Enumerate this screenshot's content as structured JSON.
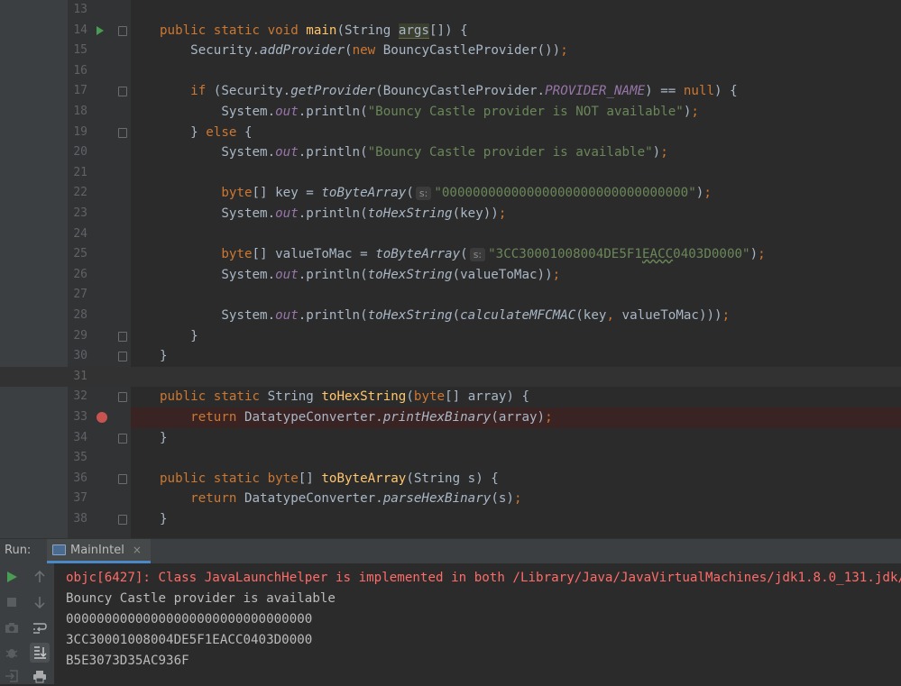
{
  "editor": {
    "lines": [
      {
        "n": "13",
        "html": ""
      },
      {
        "n": "14",
        "html": "<span class=\"kw\">public static void </span><span class=\"fn\">main</span>(String <span class=\"hl-args\">args</span>[]) {"
      },
      {
        "n": "15",
        "html": "    Security.<span class=\"it\">addProvider</span>(<span class=\"kw\">new </span>BouncyCastleProvider())<span class=\"kw\">;</span>"
      },
      {
        "n": "16",
        "html": ""
      },
      {
        "n": "17",
        "html": "    <span class=\"kw\">if </span>(Security.<span class=\"it\">getProvider</span>(BouncyCastleProvider.<span class=\"fld\">PROVIDER_NAME</span>) == <span class=\"kw\">null</span>) {"
      },
      {
        "n": "18",
        "html": "        System.<span class=\"fld\">out</span>.println(<span class=\"st\">\"Bouncy Castle provider is NOT available\"</span>)<span class=\"kw\">;</span>"
      },
      {
        "n": "19",
        "html": "    } <span class=\"kw\">else </span>{"
      },
      {
        "n": "20",
        "html": "        System.<span class=\"fld\">out</span>.println(<span class=\"st\">\"Bouncy Castle provider is available\"</span>)<span class=\"kw\">;</span>"
      },
      {
        "n": "21",
        "html": ""
      },
      {
        "n": "22",
        "html": "        <span class=\"kw\">byte</span>[] key = <span class=\"it\">toByteArray</span>(<span class=\"hint\">s:</span><span class=\"st\">\"00000000000000000000000000000000\"</span>)<span class=\"kw\">;</span>"
      },
      {
        "n": "23",
        "html": "        System.<span class=\"fld\">out</span>.println(<span class=\"it\">toHexString</span>(key))<span class=\"kw\">;</span>"
      },
      {
        "n": "24",
        "html": ""
      },
      {
        "n": "25",
        "html": "        <span class=\"kw\">byte</span>[] valueToMac = <span class=\"it\">toByteArray</span>(<span class=\"hint\">s:</span><span class=\"st\">\"3CC30001008004DE5F1<span class=\"typo\">EACC</span>0403D0000\"</span>)<span class=\"kw\">;</span>"
      },
      {
        "n": "26",
        "html": "        System.<span class=\"fld\">out</span>.println(<span class=\"it\">toHexString</span>(valueToMac))<span class=\"kw\">;</span>"
      },
      {
        "n": "27",
        "html": ""
      },
      {
        "n": "28",
        "html": "        System.<span class=\"fld\">out</span>.println(<span class=\"it\">toHexString</span>(<span class=\"it\">calculateMFCMAC</span>(key<span class=\"kw\">, </span>valueToMac)))<span class=\"kw\">;</span>"
      },
      {
        "n": "29",
        "html": "    }"
      },
      {
        "n": "30",
        "html": "}"
      },
      {
        "n": "31",
        "html": ""
      },
      {
        "n": "32",
        "html": "<span class=\"kw\">public static </span>String <span class=\"fn\">toHexString</span>(<span class=\"kw\">byte</span>[] array) {"
      },
      {
        "n": "33",
        "html": "    <span class=\"kw\">return </span>DatatypeConverter.<span class=\"it\">printHexBinary</span>(array)<span class=\"kw\">;</span>"
      },
      {
        "n": "34",
        "html": "}"
      },
      {
        "n": "35",
        "html": ""
      },
      {
        "n": "36",
        "html": "<span class=\"kw\">public static byte</span>[] <span class=\"fn\">toByteArray</span>(String s) {"
      },
      {
        "n": "37",
        "html": "    <span class=\"kw\">return </span>DatatypeConverter.<span class=\"it\">parseHexBinary</span>(s)<span class=\"kw\">;</span>"
      },
      {
        "n": "38",
        "html": "}"
      }
    ]
  },
  "run_panel": {
    "label": "Run:",
    "tab_label": "MainIntel",
    "tab_close": "×",
    "console": {
      "error_line": "objc[6427]: Class JavaLaunchHelper is implemented in both /Library/Java/JavaVirtualMachines/jdk1.8.0_131.jdk/",
      "out1": "Bouncy Castle provider is available",
      "out2": "00000000000000000000000000000000",
      "out3": "3CC30001008004DE5F1EACC0403D0000",
      "out4": "B5E3073D35AC936F"
    }
  },
  "colors": {
    "keyword": "#cc7832",
    "function": "#ffc66d",
    "string": "#6a8759",
    "field": "#9876aa",
    "error": "#ff6b68",
    "breakpoint": "#c75450",
    "run": "#499c54"
  }
}
